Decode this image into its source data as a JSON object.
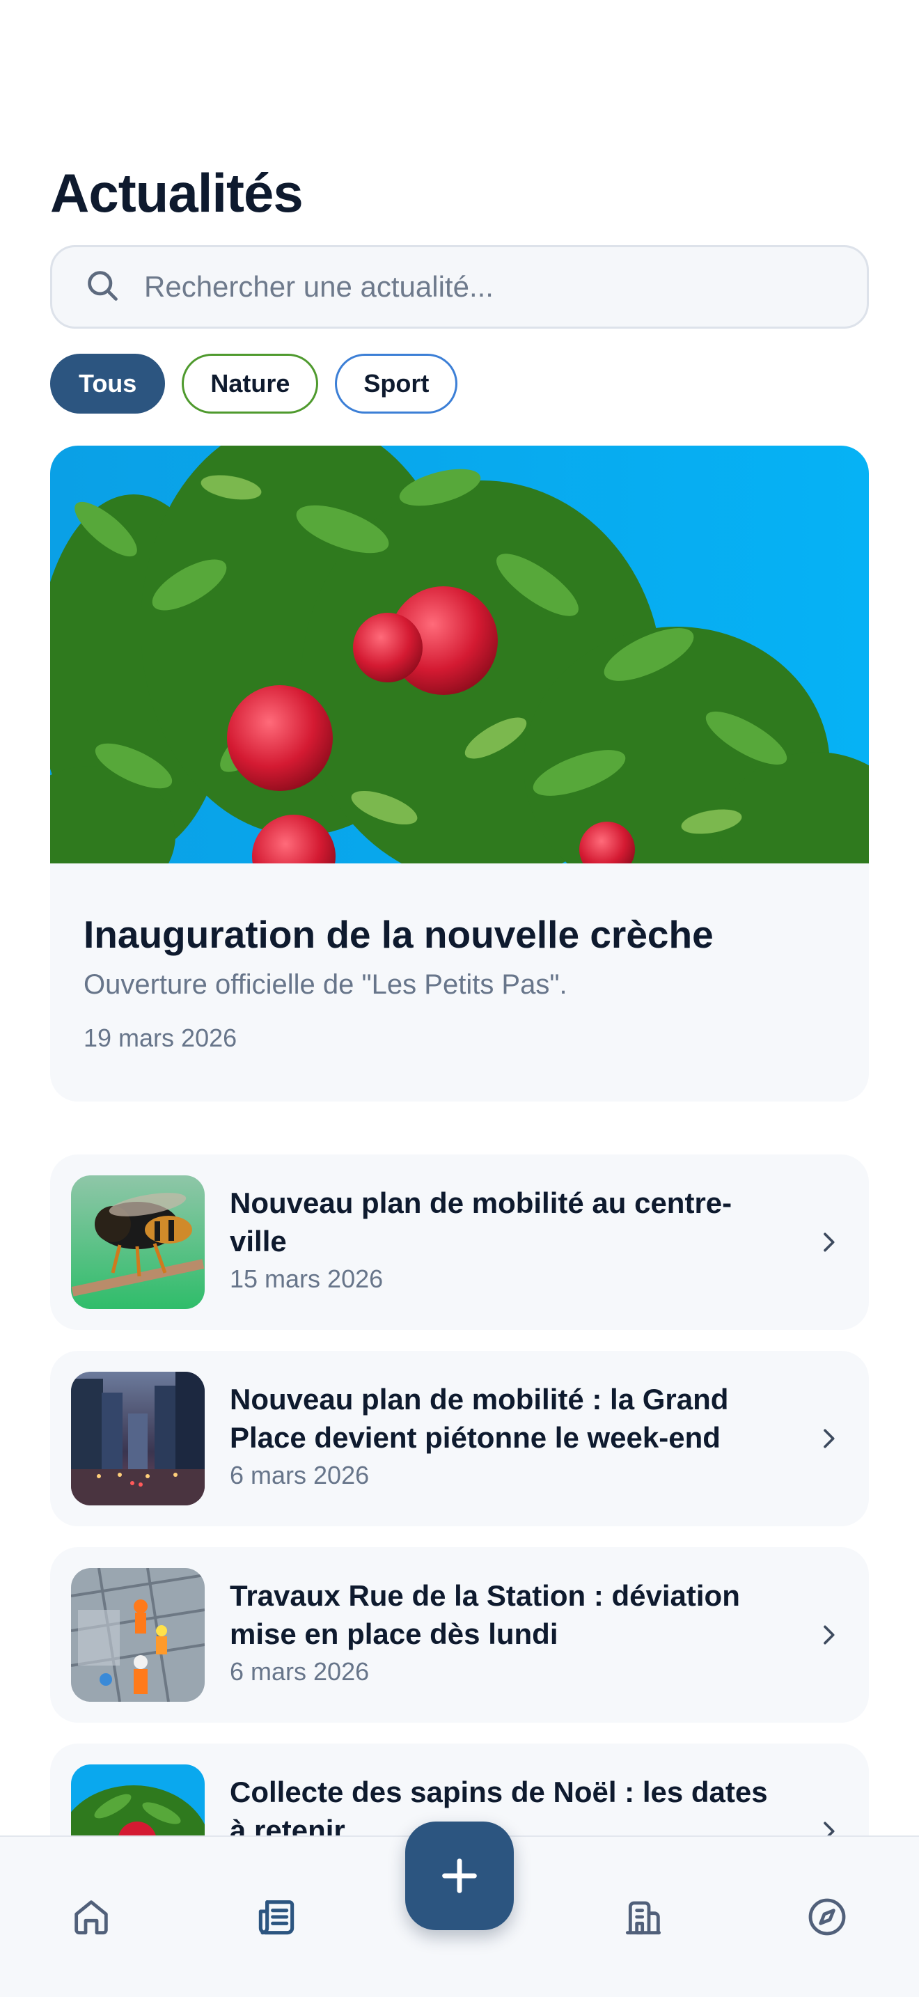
{
  "header": {
    "title": "Actualités"
  },
  "search": {
    "placeholder": "Rechercher une actualité...",
    "value": ""
  },
  "filters": [
    {
      "label": "Tous",
      "active": true,
      "color": "#2c5580"
    },
    {
      "label": "Nature",
      "active": false,
      "color": "#4f9a2e"
    },
    {
      "label": "Sport",
      "active": false,
      "color": "#3c7fd6"
    }
  ],
  "featured": {
    "title": "Inauguration de la nouvelle crèche",
    "subtitle": "Ouverture officielle de \"Les Petits Pas\".",
    "date": "19 mars 2026",
    "image": "apple-tree-photo"
  },
  "articles": [
    {
      "title": "Nouveau plan de mobilité au centre-ville",
      "date": "15 mars 2026",
      "image": "wasp-photo"
    },
    {
      "title": "Nouveau plan de mobilité : la Grand Place devient piétonne le week-end",
      "date": "6 mars 2026",
      "image": "city-street-photo"
    },
    {
      "title": "Travaux Rue de la Station : déviation mise en place dès lundi",
      "date": "6 mars 2026",
      "image": "construction-workers-photo"
    },
    {
      "title": "Collecte des sapins de Noël : les dates à retenir",
      "date": "",
      "image": "apple-tree-photo"
    }
  ],
  "nav": {
    "items": [
      {
        "icon": "home-icon"
      },
      {
        "icon": "newspaper-icon",
        "active": true
      },
      {
        "icon": "plus-icon"
      },
      {
        "icon": "building-icon"
      },
      {
        "icon": "compass-icon"
      }
    ]
  },
  "colors": {
    "primary": "#2c5580",
    "text": "#0e1a2e",
    "muted": "#67758a"
  }
}
